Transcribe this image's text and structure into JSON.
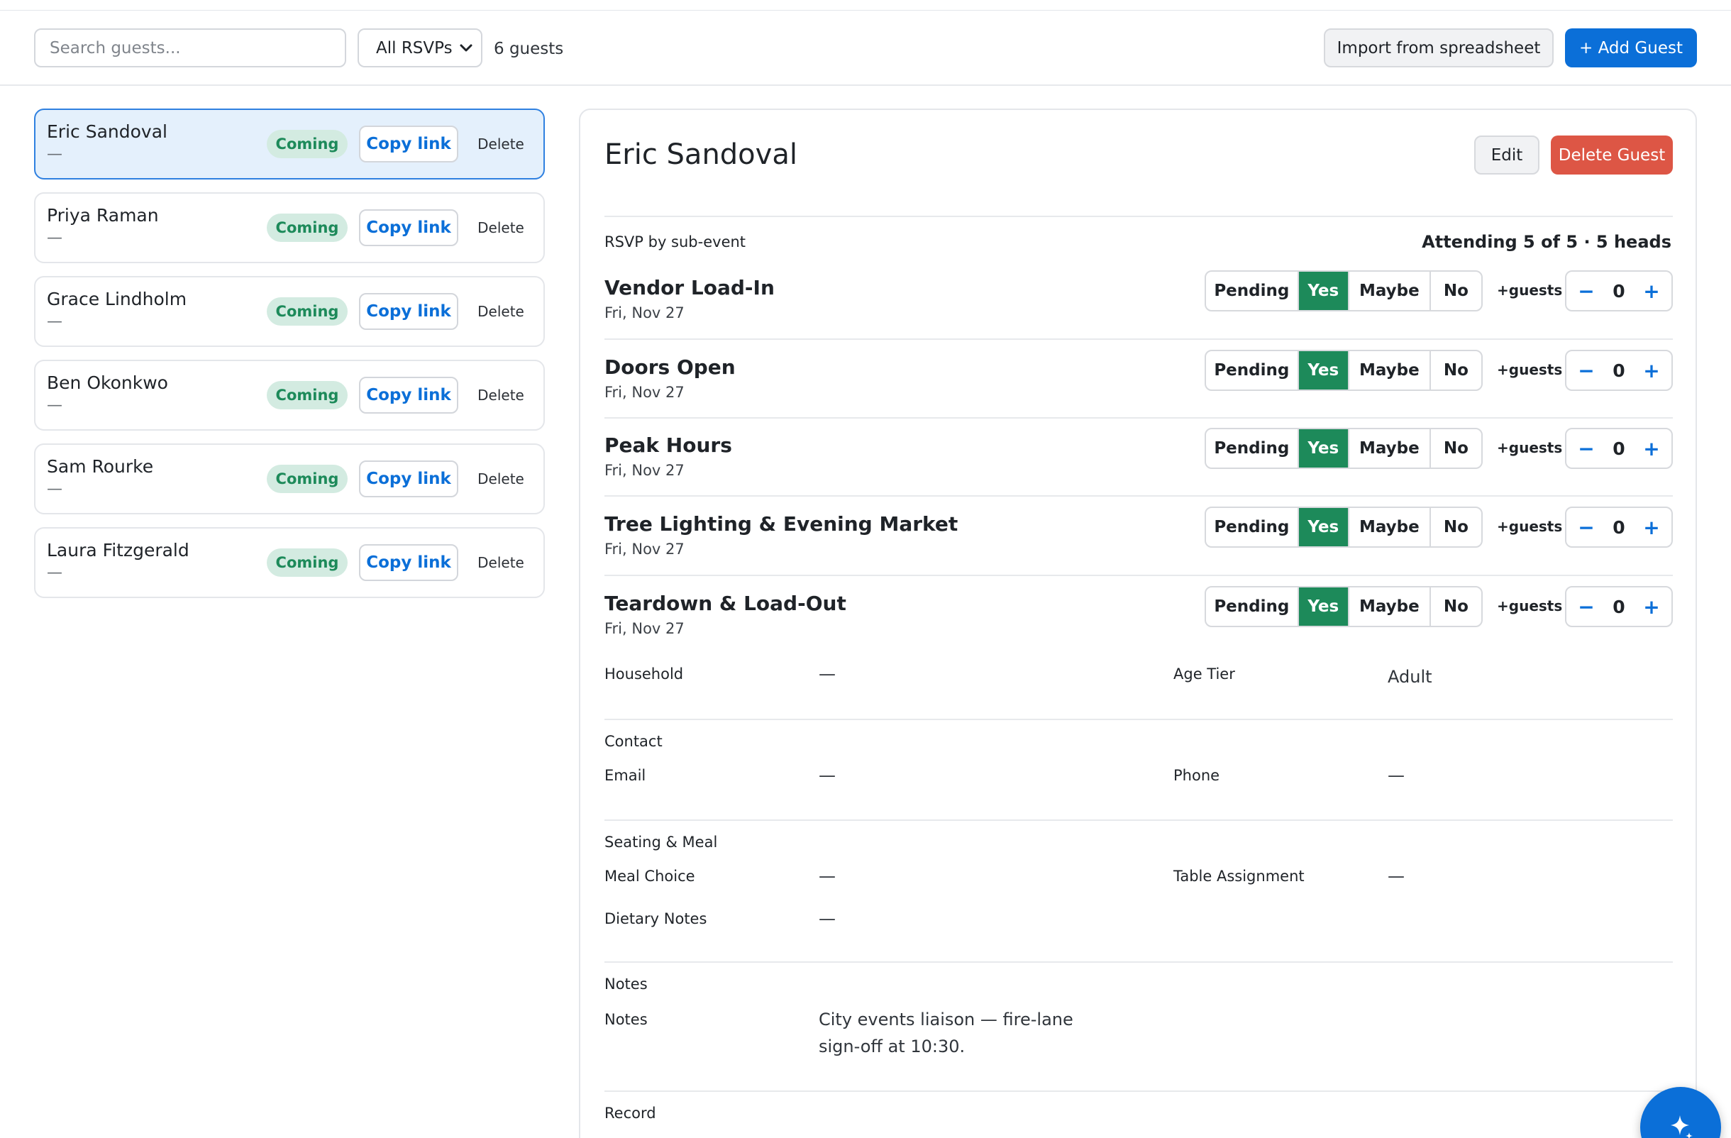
{
  "toolbar": {
    "search_placeholder": "Search guests...",
    "rsvp_filter": "All RSVPs",
    "guest_count": "6 guests",
    "import_label": "Import from spreadsheet",
    "add_label": "+ Add Guest"
  },
  "guests": [
    {
      "name": "Eric Sandoval",
      "sub": "—",
      "status": "Coming",
      "copy": "Copy link",
      "delete": "Delete",
      "selected": true
    },
    {
      "name": "Priya Raman",
      "sub": "—",
      "status": "Coming",
      "copy": "Copy link",
      "delete": "Delete"
    },
    {
      "name": "Grace Lindholm",
      "sub": "—",
      "status": "Coming",
      "copy": "Copy link",
      "delete": "Delete"
    },
    {
      "name": "Ben Okonkwo",
      "sub": "—",
      "status": "Coming",
      "copy": "Copy link",
      "delete": "Delete"
    },
    {
      "name": "Sam Rourke",
      "sub": "—",
      "status": "Coming",
      "copy": "Copy link",
      "delete": "Delete"
    },
    {
      "name": "Laura Fitzgerald",
      "sub": "—",
      "status": "Coming",
      "copy": "Copy link",
      "delete": "Delete"
    }
  ],
  "detail": {
    "title": "Eric Sandoval",
    "edit_label": "Edit",
    "delete_label": "Delete Guest",
    "rsvp_label": "RSVP by sub-event",
    "attending": "Attending 5 of 5 · 5 heads",
    "rsvp_options": [
      "Pending",
      "Yes",
      "Maybe",
      "No"
    ],
    "plus_guests_label": "+guests",
    "sub_events": [
      {
        "name": "Vendor Load-In",
        "date": "Fri, Nov 27",
        "selected": "Yes",
        "extra": "0"
      },
      {
        "name": "Doors Open",
        "date": "Fri, Nov 27",
        "selected": "Yes",
        "extra": "0"
      },
      {
        "name": "Peak Hours",
        "date": "Fri, Nov 27",
        "selected": "Yes",
        "extra": "0"
      },
      {
        "name": "Tree Lighting & Evening Market",
        "date": "Fri, Nov 27",
        "selected": "Yes",
        "extra": "0"
      },
      {
        "name": "Teardown & Load-Out",
        "date": "Fri, Nov 27",
        "selected": "Yes",
        "extra": "0"
      }
    ],
    "household": {
      "label": "Household",
      "value": "—"
    },
    "age_tier": {
      "label": "Age Tier",
      "value": "Adult"
    },
    "contact": {
      "heading": "Contact",
      "email": {
        "label": "Email",
        "value": "—"
      },
      "phone": {
        "label": "Phone",
        "value": "—"
      }
    },
    "seating": {
      "heading": "Seating & Meal",
      "meal": {
        "label": "Meal Choice",
        "value": "—"
      },
      "table": {
        "label": "Table Assignment",
        "value": "—"
      },
      "dietary": {
        "label": "Dietary Notes",
        "value": "—"
      }
    },
    "notes": {
      "heading": "Notes",
      "label": "Notes",
      "line1": "City events liaison — fire-lane",
      "line2": "sign-off at 10:30."
    },
    "record": {
      "heading": "Record"
    }
  },
  "colors": {
    "accent": "#0b6fd8",
    "yes": "#1d8a5a",
    "danger": "#dd5645",
    "selected_bg": "#e4f0fc"
  },
  "icons": {
    "filter": "chevron-down-icon",
    "fab": "sparkle-icon"
  }
}
